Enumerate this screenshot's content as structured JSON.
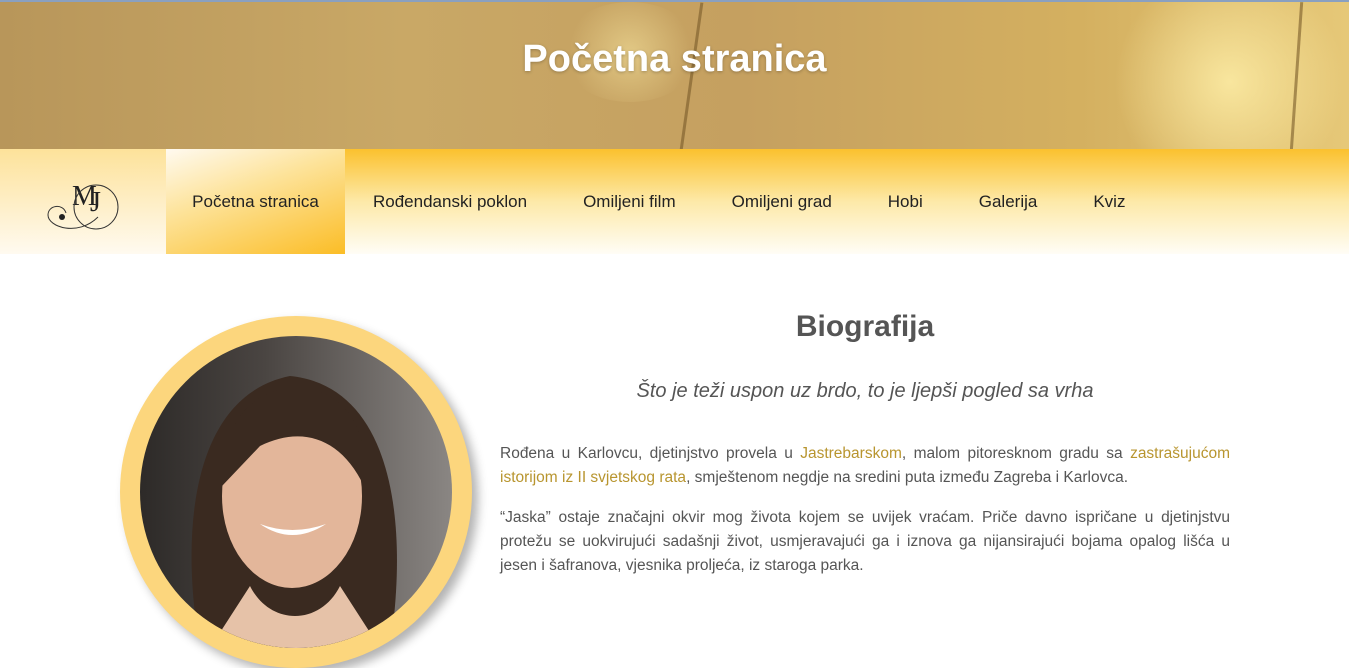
{
  "banner": {
    "title": "Početna stranica"
  },
  "logo": {
    "text": "MJ"
  },
  "nav": {
    "items": [
      "Početna stranica",
      "Rođendanski poklon",
      "Omiljeni film",
      "Omiljeni grad",
      "Hobi",
      "Galerija",
      "Kviz"
    ],
    "active": 0
  },
  "main": {
    "heading": "Biografija",
    "quote": "Što je teži uspon uz brdo, to je ljepši pogled sa vrha",
    "p1": {
      "t1": "Rođena u Karlovcu, djetinjstvo provela u ",
      "link1": "Jastrebarskom",
      "t2": ", malom pitoresknom gradu sa ",
      "link2": "zastrašujućom istorijom iz II svjetskog rata",
      "t3": ", smještenom negdje na sredini puta između Zagreba i Karlovca."
    },
    "p2": "“Jaska” ostaje značajni okvir mog života kojem se uvijek vraćam. Priče davno ispričane u djetinjstvu protežu se uokvirujući sadašnji život, usmjeravajući ga i iznova ga nijansirajući bojama opalog lišća u jesen i šafranova, vjesnika proljeća, iz staroga parka."
  },
  "colors": {
    "accent": "#fbc12e",
    "link": "#b8952f",
    "ring": "#fcd67d"
  }
}
